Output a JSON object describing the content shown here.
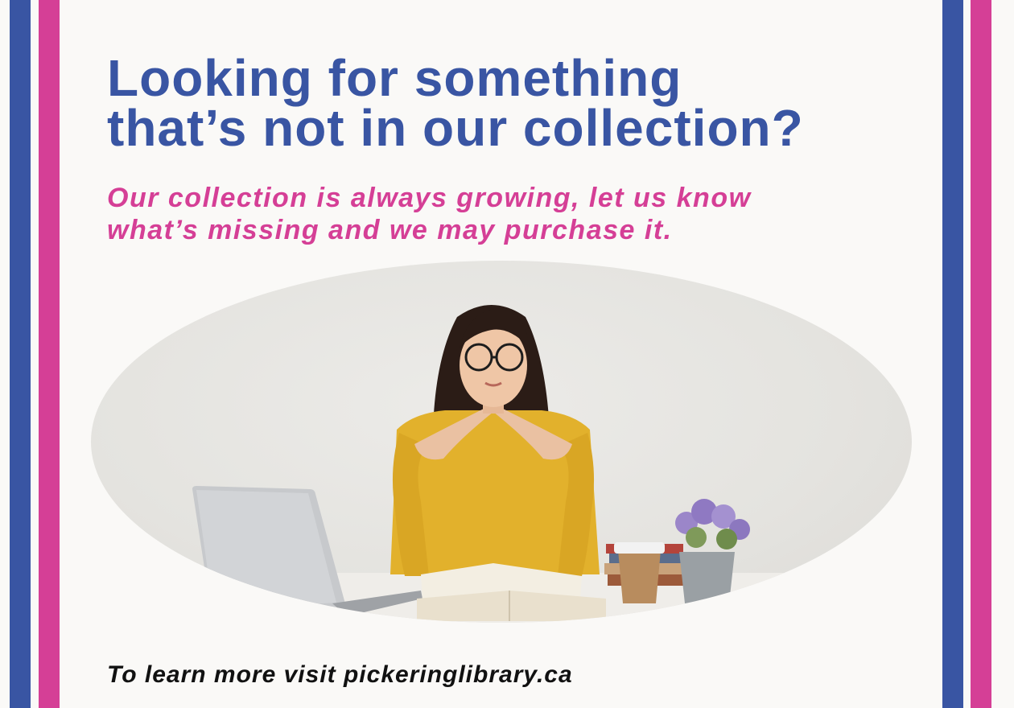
{
  "poster": {
    "headline_line1": "Looking for something",
    "headline_line2": "that’s not in our collection?",
    "subhead_line1": "Our collection is always growing, let us know",
    "subhead_line2": "what’s missing and we may purchase it.",
    "footer": "To learn more visit pickeringlibrary.ca"
  },
  "colors": {
    "blue": "#3955a3",
    "pink": "#d53f96",
    "background": "#faf9f7",
    "footer_text": "#111111"
  },
  "photo": {
    "subject": "woman-at-desk-with-laptop-books-coffee-and-plant"
  }
}
